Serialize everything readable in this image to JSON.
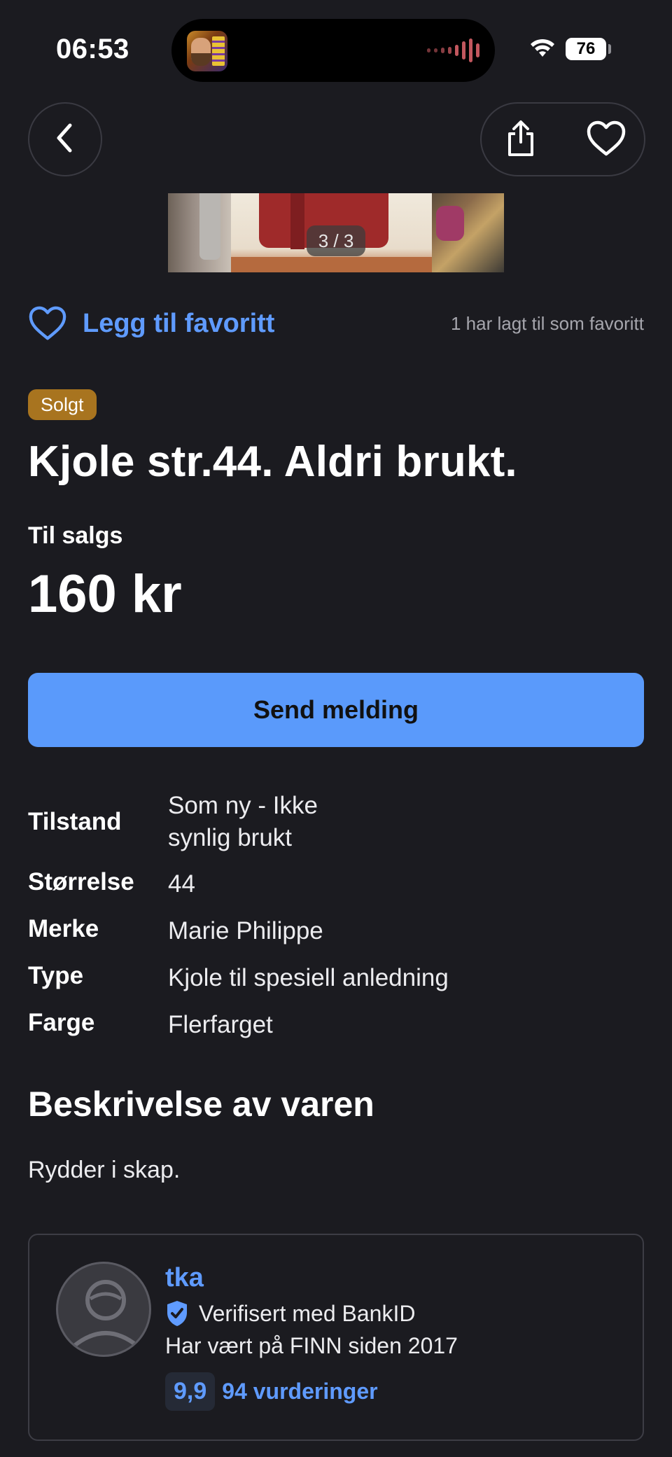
{
  "status_bar": {
    "time": "06:53",
    "battery": "76"
  },
  "gallery": {
    "counter": "3 / 3"
  },
  "favorite": {
    "label": "Legg til favoritt",
    "count_text": "1 har lagt til som favoritt"
  },
  "listing": {
    "badge": "Solgt",
    "title": "Kjole str.44. Aldri brukt.",
    "sale_type": "Til salgs",
    "price": "160 kr"
  },
  "actions": {
    "send_message": "Send melding"
  },
  "attributes": [
    {
      "key": "Tilstand",
      "value": "Som ny - Ikke synlig brukt"
    },
    {
      "key": "Størrelse",
      "value": "44"
    },
    {
      "key": "Merke",
      "value": "Marie Philippe"
    },
    {
      "key": "Type",
      "value": "Kjole til spesiell anledning"
    },
    {
      "key": "Farge",
      "value": "Flerfarget"
    }
  ],
  "description": {
    "heading": "Beskrivelse av varen",
    "text": "Rydder i skap."
  },
  "seller": {
    "name": "tka",
    "verified": "Verifisert med BankID",
    "member_since": "Har vært på FINN siden 2017",
    "rating": "9,9",
    "reviews": "94 vurderinger"
  },
  "colors": {
    "background": "#1b1b20",
    "accent": "#5f9bff",
    "button": "#5a9afb",
    "sold_badge": "#a8741f"
  },
  "icons": [
    "back-chevron-icon",
    "share-icon",
    "heart-icon",
    "wifi-icon",
    "battery-icon",
    "shield-check-icon",
    "avatar-placeholder-icon"
  ]
}
